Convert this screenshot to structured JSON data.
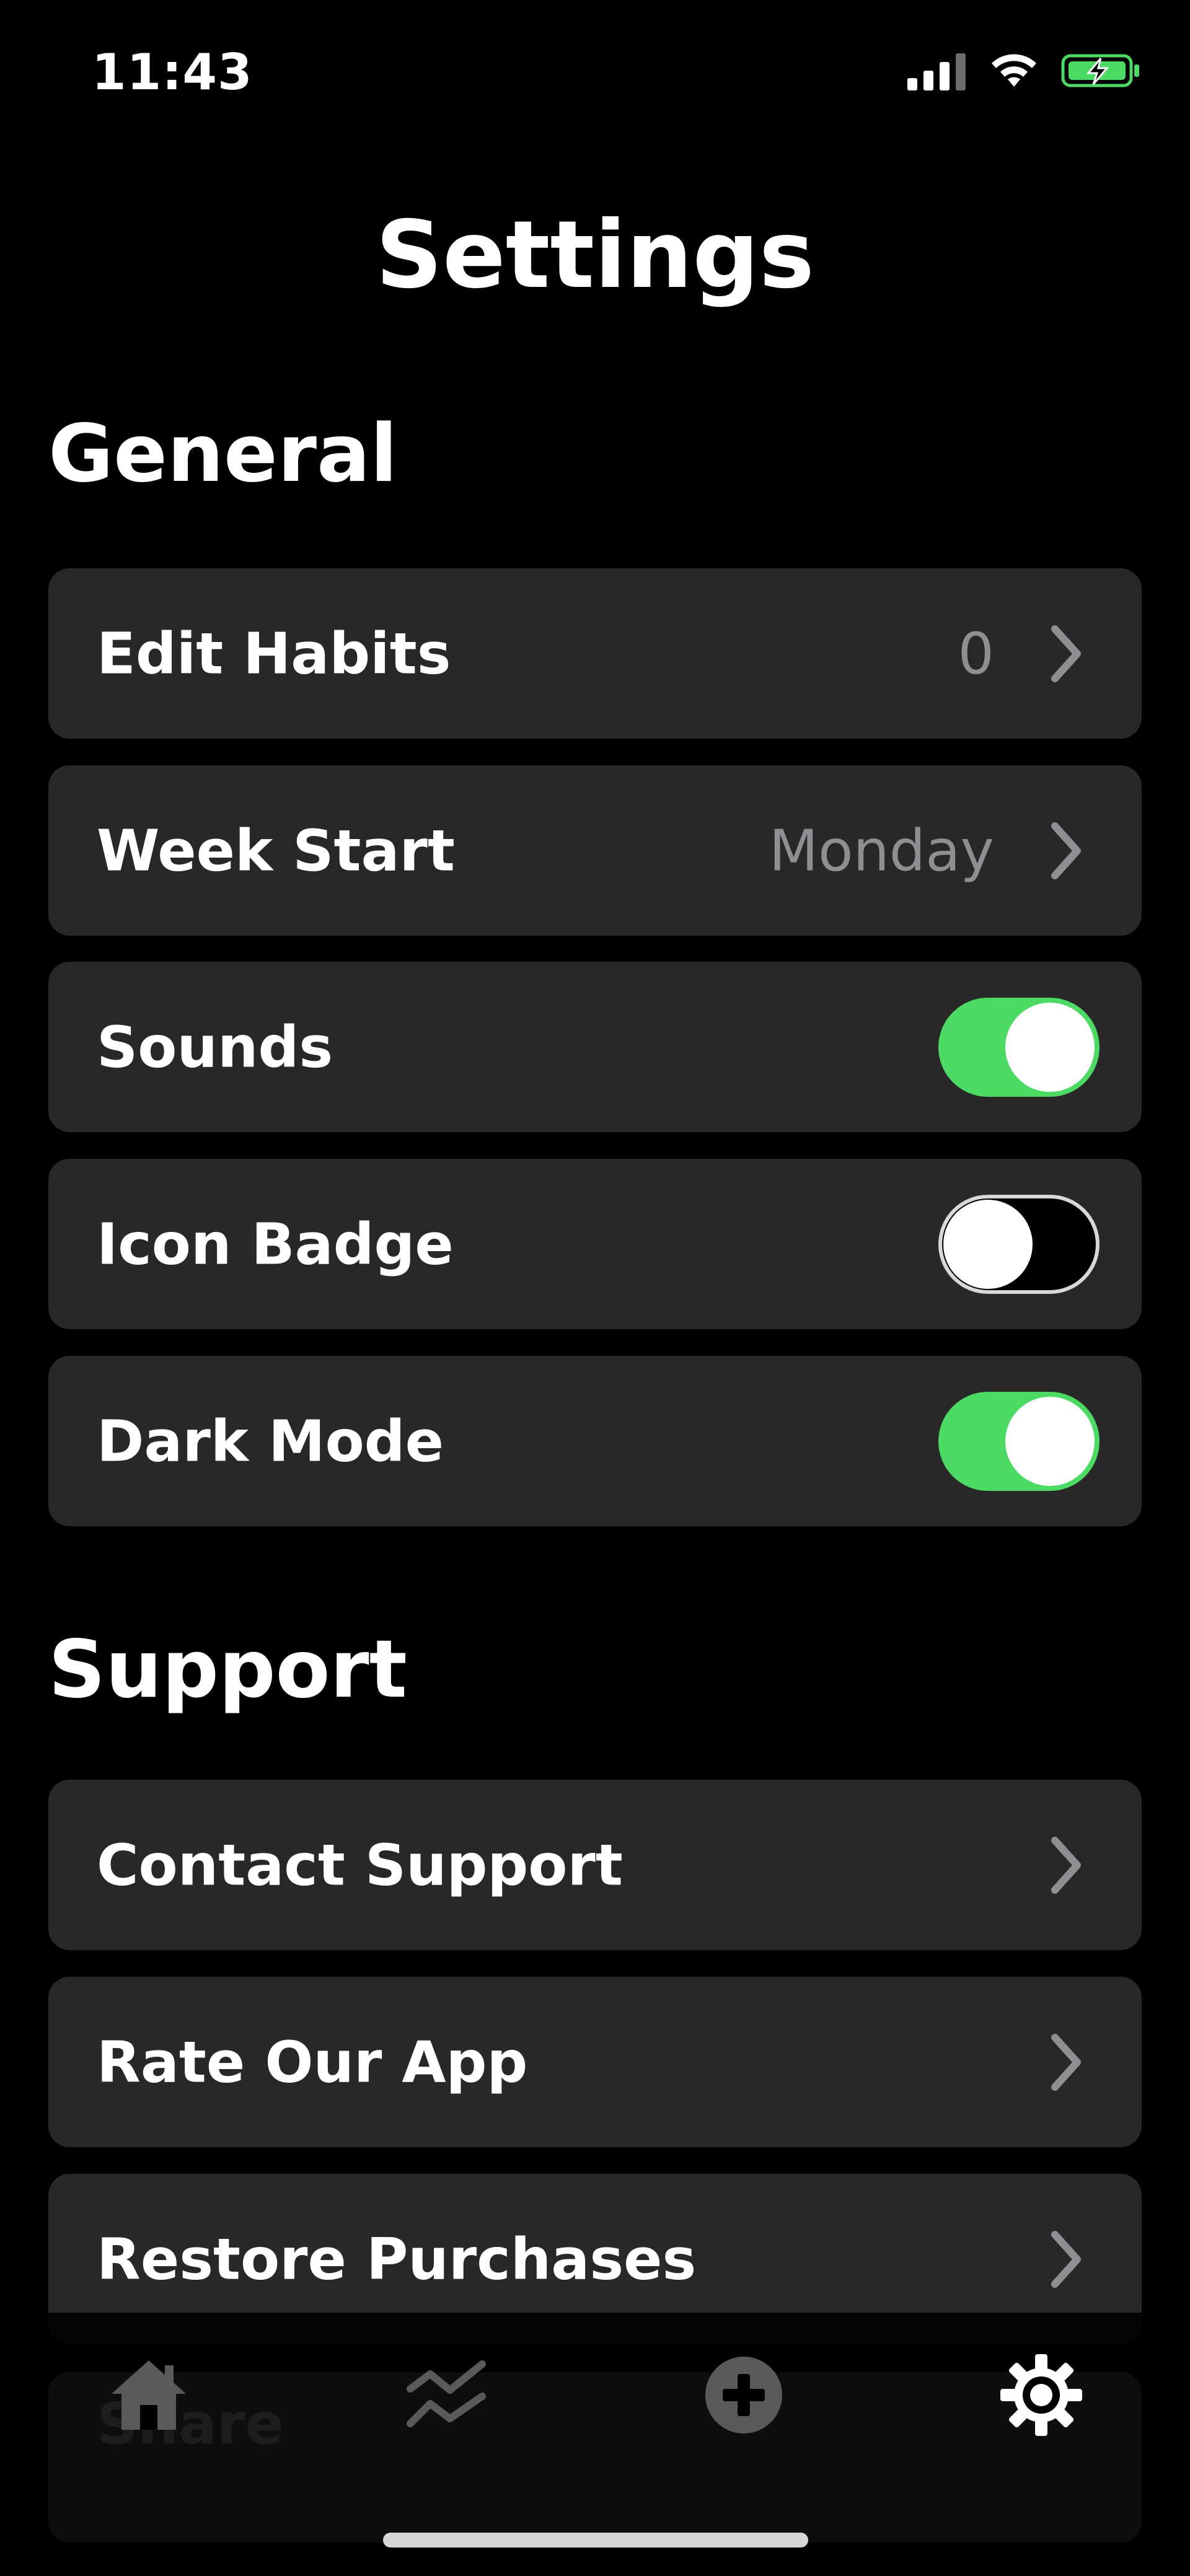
{
  "status_bar": {
    "time": "11:43",
    "icons": [
      "signal-icon",
      "wifi-icon",
      "battery-charging-icon"
    ],
    "battery_color": "#4cd964"
  },
  "header": {
    "title": "Settings"
  },
  "sections": {
    "general": {
      "title": "General",
      "items": [
        {
          "label": "Edit Habits",
          "value": "0",
          "type": "disclosure"
        },
        {
          "label": "Week Start",
          "value": "Monday",
          "type": "disclosure"
        },
        {
          "label": "Sounds",
          "type": "toggle",
          "on": true
        },
        {
          "label": "Icon Badge",
          "type": "toggle",
          "on": false
        },
        {
          "label": "Dark Mode",
          "type": "toggle",
          "on": true
        }
      ]
    },
    "support": {
      "title": "Support",
      "items": [
        {
          "label": "Contact Support",
          "type": "disclosure"
        },
        {
          "label": "Rate Our App",
          "type": "disclosure"
        },
        {
          "label": "Restore Purchases",
          "type": "disclosure"
        },
        {
          "label": "Share",
          "type": "disclosure"
        }
      ]
    }
  },
  "tab_bar": {
    "tabs": [
      {
        "icon": "home-icon",
        "active": false
      },
      {
        "icon": "stats-icon",
        "active": false
      },
      {
        "icon": "add-icon",
        "active": false
      },
      {
        "icon": "gear-icon",
        "active": true
      }
    ]
  },
  "colors": {
    "background": "#000000",
    "row_background": "#282828",
    "toggle_on": "#4cd964",
    "secondary_text": "#8e8e93",
    "inactive_tab": "#5a5a5a",
    "active_tab": "#ffffff"
  }
}
